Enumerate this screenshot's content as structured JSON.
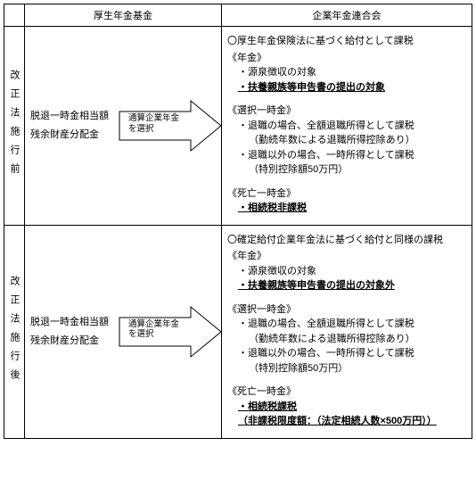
{
  "header": {
    "col_mid": "厚生年金基金",
    "col_right": "企業年金連合会"
  },
  "arrow_label": "通算企業年金を選択",
  "before": {
    "side": "改正法施行前",
    "mid_line1": "脱退一時金相当額",
    "mid_line2": "残余財産分配金",
    "right": {
      "title": "〇厚生年金保険法に基づく給付として課税",
      "sec_nenkin": "《年金》",
      "nenkin_b1": "・源泉徴収の対象",
      "nenkin_u": "・扶養親族等申告書の提出の対象",
      "sec_sentaku": "《選択一時金》",
      "sentaku_b1": "・退職の場合、全額退職所得として課税",
      "sentaku_n1": "（勤続年数による退職所得控除あり）",
      "sentaku_b2": "・退職以外の場合、一時所得として課税",
      "sentaku_n2": "（特別控除額50万円）",
      "sec_shibo": "《死亡一時金》",
      "shibo_u": "・相続税非課税"
    }
  },
  "after": {
    "side": "改正法施行後",
    "mid_line1": "脱退一時金相当額",
    "mid_line2": "残余財産分配金",
    "right": {
      "title": "〇確定給付企業年金法に基づく給付と同様の課税",
      "sec_nenkin": "《年金》",
      "nenkin_b1": "・源泉徴収の対象",
      "nenkin_u": "・扶養親族等申告書の提出の対象外",
      "sec_sentaku": "《選択一時金》",
      "sentaku_b1": "・退職の場合、全額退職所得として課税",
      "sentaku_n1": "（勤続年数による退職所得控除あり）",
      "sentaku_b2": "・退職以外の場合、一時所得として課税",
      "sentaku_n2": "（特別控除額50万円）",
      "sec_shibo": "《死亡一時金》",
      "shibo_u1": "・相続税課税",
      "shibo_u2": "（非課税限度額：（法定相続人数×500万円））"
    }
  }
}
